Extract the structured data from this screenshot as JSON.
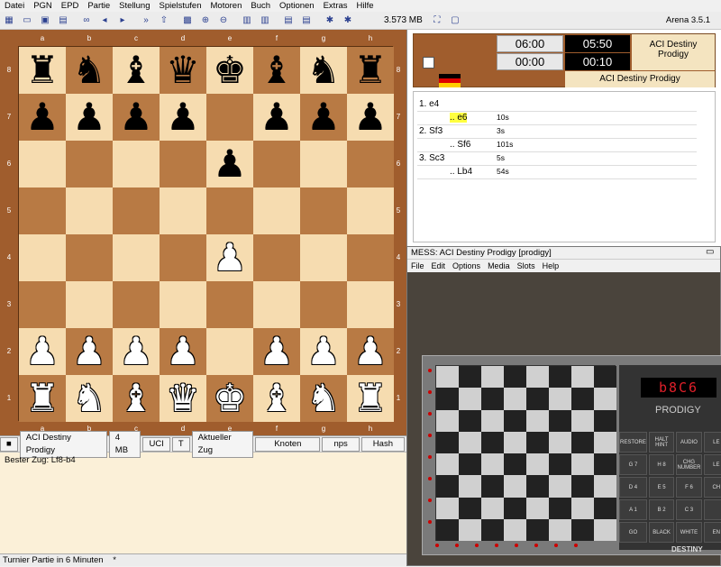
{
  "menubar": [
    "Datei",
    "PGN",
    "EPD",
    "Partie",
    "Stellung",
    "Spielstufen",
    "Motoren",
    "Buch",
    "Optionen",
    "Extras",
    "Hilfe"
  ],
  "toolbar": {
    "memory": "3.573 MB",
    "version": "Arena 3.5.1"
  },
  "board": {
    "files": [
      "a",
      "b",
      "c",
      "d",
      "e",
      "f",
      "g",
      "h"
    ],
    "ranks": [
      "8",
      "7",
      "6",
      "5",
      "4",
      "3",
      "2",
      "1"
    ],
    "position": [
      [
        "br",
        "bn",
        "bb",
        "bq",
        "bk",
        "bb",
        "bn",
        "br"
      ],
      [
        "bp",
        "bp",
        "bp",
        "bp",
        "",
        "bp",
        "bp",
        "bp"
      ],
      [
        "",
        "",
        "",
        "",
        "bp",
        "",
        "",
        ""
      ],
      [
        "",
        "",
        "",
        "",
        "",
        "",
        "",
        ""
      ],
      [
        "",
        "",
        "",
        "",
        "wp",
        "",
        "",
        ""
      ],
      [
        "",
        "",
        "",
        "",
        "",
        "",
        "",
        ""
      ],
      [
        "wp",
        "wp",
        "wp",
        "wp",
        "",
        "wp",
        "wp",
        "wp"
      ],
      [
        "wr",
        "wn",
        "wb",
        "wq",
        "wk",
        "wb",
        "wn",
        "wr"
      ]
    ]
  },
  "clocks": {
    "white_top": "06:00",
    "white_bottom": "00:00",
    "black_top": "05:50",
    "black_bottom": "00:10",
    "engine_name": "ACI Destiny Prodigy",
    "engine_name_bottom": "ACI Destiny Prodigy",
    "flag_colors": [
      "#000000",
      "#dd0000",
      "#ffce00"
    ]
  },
  "moves": [
    {
      "num": "1. e4",
      "move": "",
      "time": ""
    },
    {
      "num": "",
      "move": ".. e6",
      "time": "10s",
      "highlight": true
    },
    {
      "num": "2. Sf3",
      "move": "",
      "time": "3s"
    },
    {
      "num": "",
      "move": ".. Sf6",
      "time": "101s"
    },
    {
      "num": "3. Sc3",
      "move": "",
      "time": "5s"
    },
    {
      "num": "",
      "move": ".. Lb4",
      "time": "54s"
    }
  ],
  "engine": {
    "name": "ACI Destiny Prodigy",
    "memory": "4 MB",
    "protocol": "UCI",
    "t": "T",
    "current_move": "Aktueller Zug",
    "nodes": "Knoten",
    "nps": "nps",
    "hash": "Hash",
    "best_move": "Bester Zug: Lf8-b4"
  },
  "status": {
    "text": "Turnier Partie in 6 Minuten",
    "extra": "*"
  },
  "mess": {
    "title": "MESS: ACI Destiny Prodigy [prodigy]",
    "menu": [
      "File",
      "Edit",
      "Options",
      "Media",
      "Slots",
      "Help"
    ],
    "display": "b8C6",
    "brand": "PRODIGY",
    "logo": "DESTINY",
    "keys": [
      "RESTORE",
      "HALT HINT",
      "AUDIO",
      "LE",
      "G 7",
      "H 8",
      "CHG NUMBER",
      "LE",
      "D 4",
      "E 5",
      "F 6",
      "CH",
      "A 1",
      "B 2",
      "C 3",
      "",
      "GO",
      "BLACK",
      "WHITE",
      "EN"
    ]
  }
}
